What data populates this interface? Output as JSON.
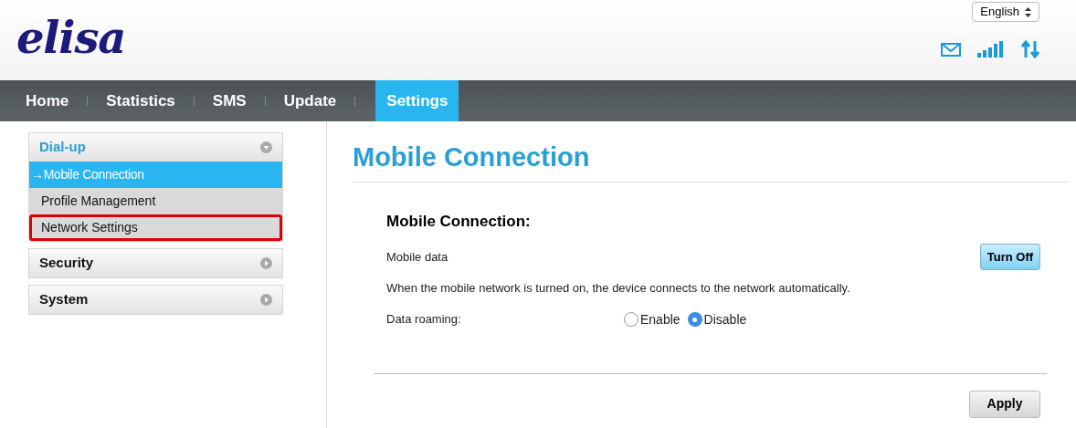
{
  "header": {
    "logo": "elisa",
    "language": "English"
  },
  "nav": {
    "tabs": [
      {
        "label": "Home",
        "selected": false
      },
      {
        "label": "Statistics",
        "selected": false
      },
      {
        "label": "SMS",
        "selected": false
      },
      {
        "label": "Update",
        "selected": false
      },
      {
        "label": "Settings",
        "selected": true
      }
    ]
  },
  "sidebar": {
    "groups": [
      {
        "label": "Dial-up",
        "expanded": true,
        "children": [
          {
            "label": "→Mobile Connection",
            "selected": true,
            "highlighted": false
          },
          {
            "label": "Profile Management",
            "selected": false,
            "highlighted": false
          },
          {
            "label": "Network Settings",
            "selected": false,
            "highlighted": true
          }
        ]
      },
      {
        "label": "Security",
        "expanded": false
      },
      {
        "label": "System",
        "expanded": false
      }
    ]
  },
  "main": {
    "title": "Mobile Connection",
    "section_title": "Mobile Connection:",
    "mobile_data_label": "Mobile data",
    "toggle_button": "Turn Off",
    "description": "When the mobile network is turned on, the device connects to the network automatically.",
    "roaming_label": "Data roaming:",
    "roaming_options": [
      {
        "label": "Enable",
        "selected": false
      },
      {
        "label": "Disable",
        "selected": true
      }
    ],
    "apply_button": "Apply"
  }
}
